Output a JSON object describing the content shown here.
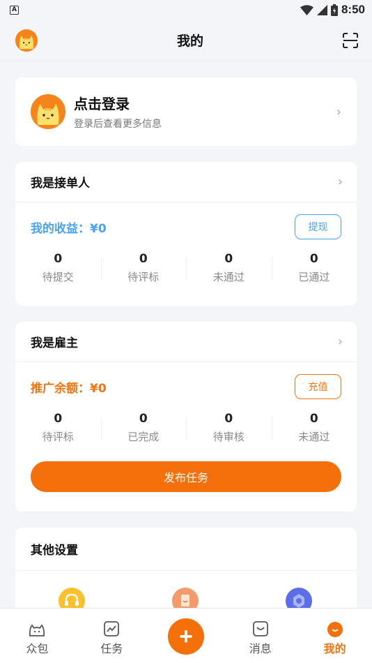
{
  "status_bar": {
    "time": "8:50",
    "left_badge": "A"
  },
  "header": {
    "title": "我的"
  },
  "login": {
    "title": "点击登录",
    "subtitle": "登录后查看更多信息"
  },
  "worker": {
    "title": "我是接单人",
    "balance_label": "我的收益：¥0",
    "button": "提现",
    "stats": [
      {
        "value": "0",
        "label": "待提交"
      },
      {
        "value": "0",
        "label": "待评标"
      },
      {
        "value": "0",
        "label": "未通过"
      },
      {
        "value": "0",
        "label": "已通过"
      }
    ]
  },
  "employer": {
    "title": "我是雇主",
    "balance_label": "推广余额：¥0",
    "button": "充值",
    "stats": [
      {
        "value": "0",
        "label": "待评标"
      },
      {
        "value": "0",
        "label": "已完成"
      },
      {
        "value": "0",
        "label": "待审核"
      },
      {
        "value": "0",
        "label": "未通过"
      }
    ],
    "publish": "发布任务"
  },
  "settings": {
    "title": "其他设置"
  },
  "tabs": [
    {
      "label": "众包",
      "icon": "crowdsource-icon"
    },
    {
      "label": "任务",
      "icon": "chart-icon"
    },
    {
      "label": "+",
      "icon": "plus-icon"
    },
    {
      "label": "消息",
      "icon": "message-icon"
    },
    {
      "label": "我的",
      "icon": "profile-icon",
      "active": true
    }
  ],
  "colors": {
    "accent": "#f5700a",
    "blue": "#4aa3f0",
    "background": "#f4f5f9"
  }
}
